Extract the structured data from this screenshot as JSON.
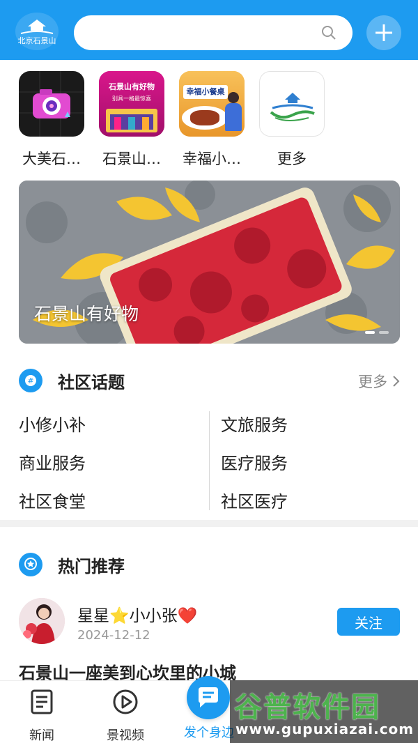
{
  "header": {
    "search_placeholder": "",
    "logo_text": "北京石景山"
  },
  "apps": [
    {
      "label": "大美石…"
    },
    {
      "label": "石景山…"
    },
    {
      "label": "幸福小…"
    },
    {
      "label": "更多"
    }
  ],
  "app_icon_text": {
    "shop_title": "石景山有好物",
    "shop_sub": "别具一格最惊喜",
    "food_title": "幸福小餐桌"
  },
  "banner": {
    "caption": "石景山有好物"
  },
  "community": {
    "title": "社区话题",
    "more": "更多",
    "topics": [
      {
        "label": "小修小补"
      },
      {
        "label": "文旅服务"
      },
      {
        "label": "商业服务"
      },
      {
        "label": "医疗服务"
      },
      {
        "label": "社区食堂"
      },
      {
        "label": "社区医疗"
      }
    ]
  },
  "hot": {
    "title": "热门推荐",
    "post": {
      "author": "星星⭐小小张❤️",
      "date": "2024-12-12",
      "follow": "关注",
      "title": "石景山一座美到心坎里的小城"
    }
  },
  "tabbar": {
    "tabs": [
      {
        "label": "新闻"
      },
      {
        "label": "景视频"
      },
      {
        "label": "发个身边"
      }
    ]
  },
  "watermark": {
    "main": "谷普软件园",
    "url": "www.gupuxiazai.com"
  },
  "colors": {
    "accent": "#1d9bf0"
  }
}
